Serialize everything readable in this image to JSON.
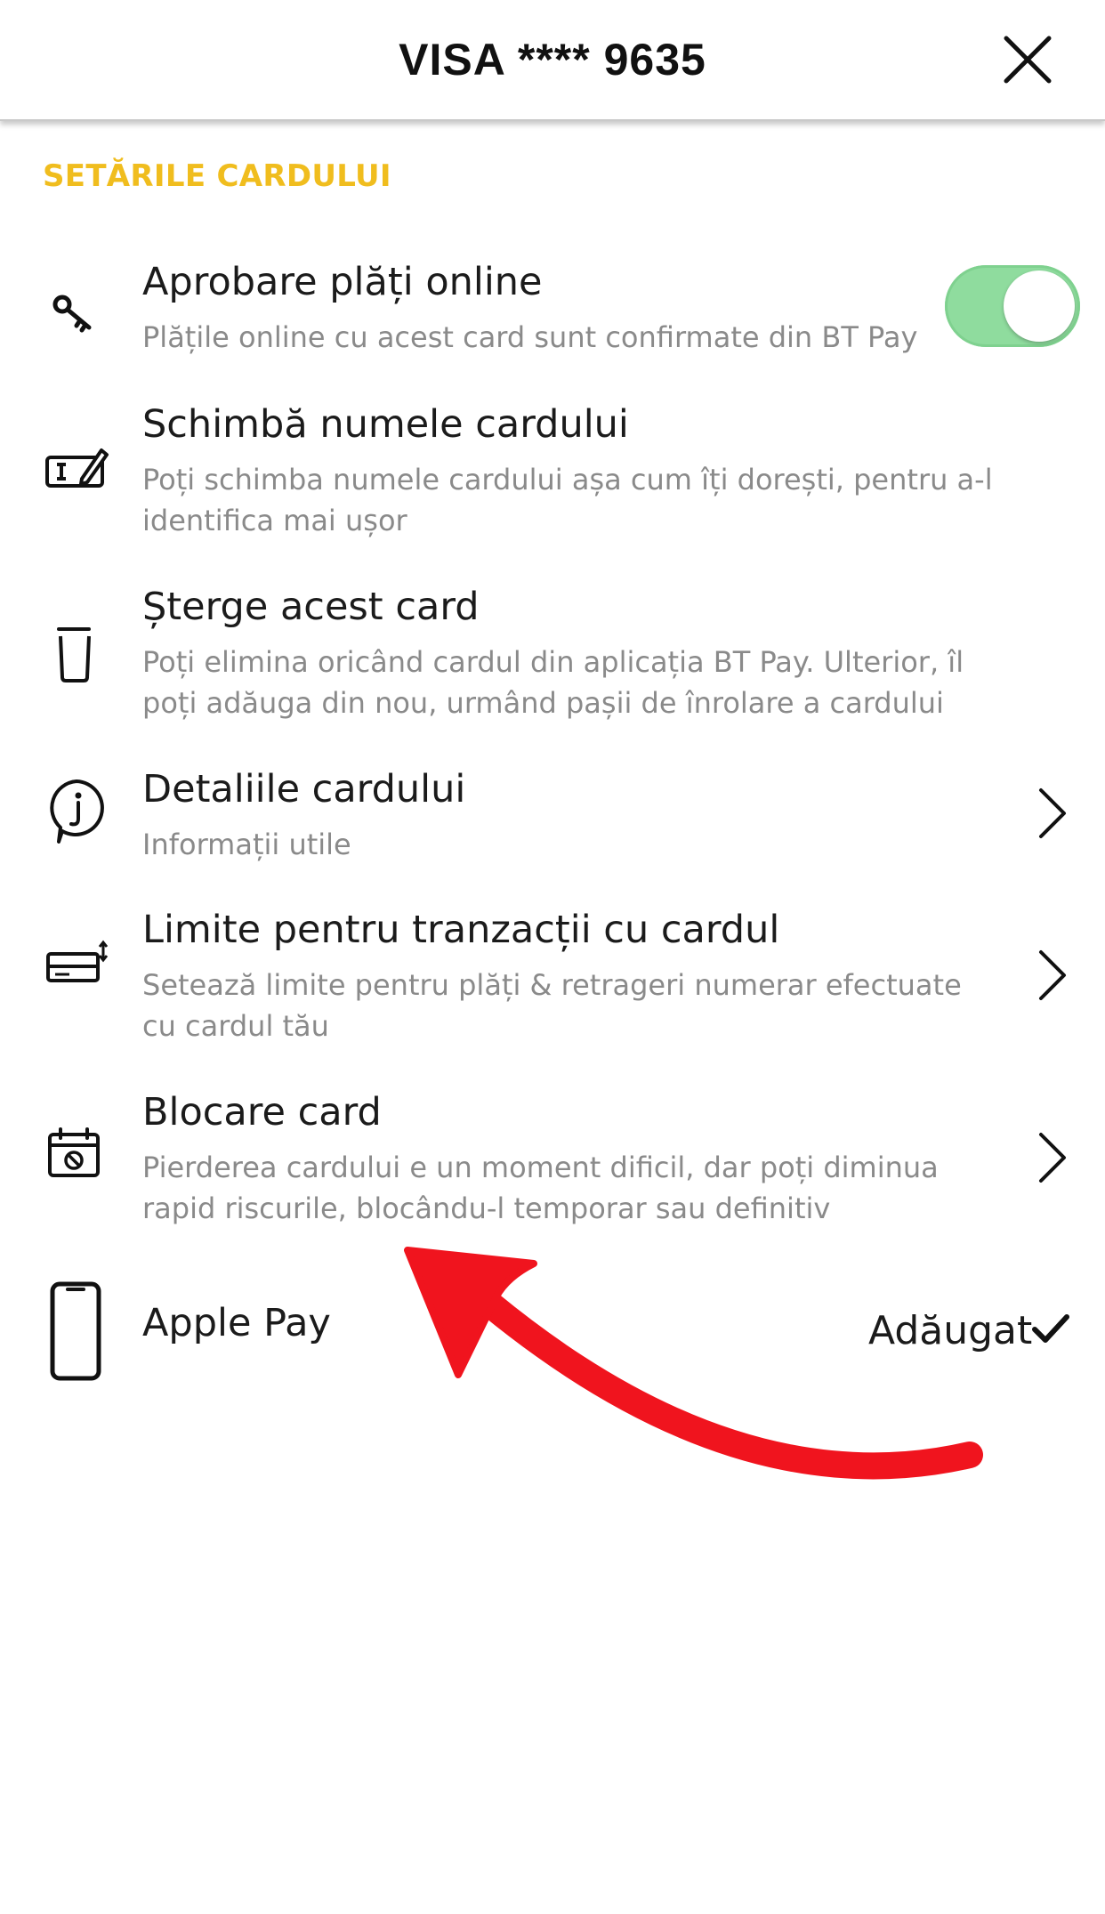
{
  "header": {
    "title": "VISA **** 9635",
    "close_icon": "close-icon"
  },
  "section": {
    "title": "SETĂRILE CARDULUI",
    "accent_color": "#f0bd1e"
  },
  "items": [
    {
      "icon": "key-icon",
      "title": "Aprobare plăți online",
      "description": "Plățile online cu acest card sunt confirmate din BT Pay",
      "control": "toggle",
      "toggle_on": true,
      "toggle_color": "#8fdc9e"
    },
    {
      "icon": "rename-card-icon",
      "title": "Schimbă numele cardului",
      "description": "Poți schimba numele cardului așa cum îți dorești, pentru a-l identifica mai ușor"
    },
    {
      "icon": "trash-icon",
      "title": "Șterge acest card",
      "description": "Poți elimina oricând cardul din aplicația BT Pay. Ulterior, îl poți adăuga din nou, urmând pașii de înrolare a cardului"
    },
    {
      "icon": "info-bubble-icon",
      "title": "Detaliile cardului",
      "description": "Informații utile",
      "control": "chevron"
    },
    {
      "icon": "card-limits-icon",
      "title": "Limite pentru tranzacții cu cardul",
      "description": "Setează limite pentru plăți & retrageri numerar efectuate cu cardul tău",
      "control": "chevron"
    },
    {
      "icon": "calendar-block-icon",
      "title": "Blocare card",
      "description": "Pierderea cardului e un moment dificil, dar poți diminua rapid riscurile, blocându-l temporar sau definitiv",
      "control": "chevron"
    }
  ],
  "apple_pay": {
    "icon": "phone-icon",
    "title": "Apple Pay",
    "status": "Adăugat",
    "status_icon": "checkmark-icon"
  },
  "annotation": {
    "icon": "red-arrow-annotation",
    "color": "#f0141e"
  }
}
